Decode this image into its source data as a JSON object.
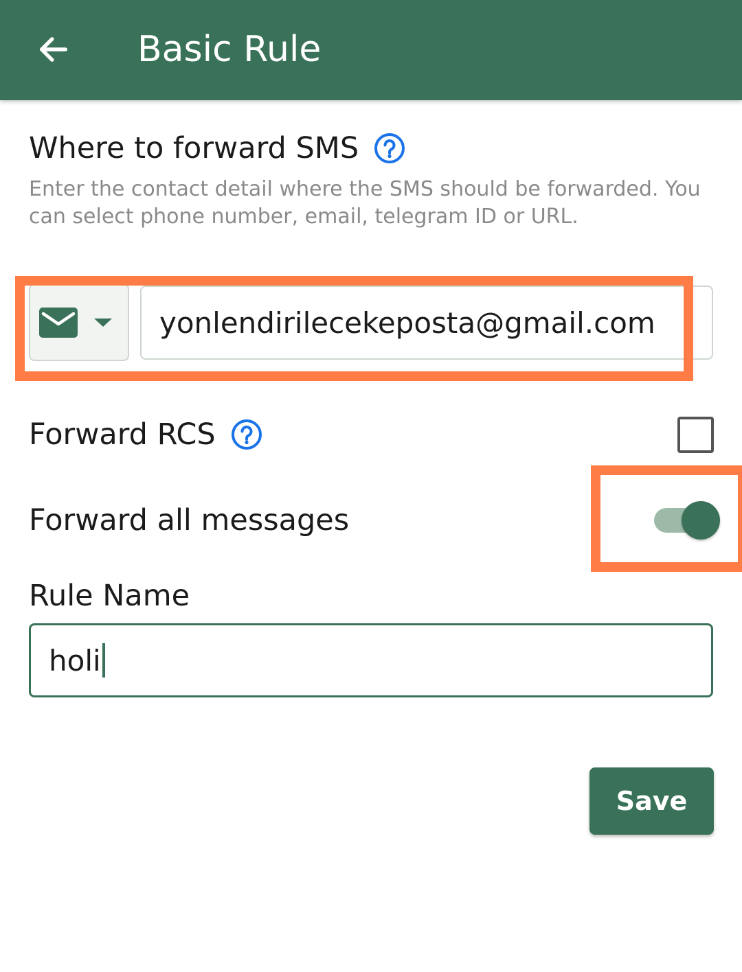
{
  "appbar": {
    "title": "Basic Rule",
    "back_icon": "arrow-left-icon"
  },
  "forward_section": {
    "title": "Where to forward SMS",
    "help_icon": "help-circle-icon",
    "description": "Enter the contact detail where the SMS should be forwarded. You can select phone number, email, telegram ID or URL.",
    "destination_type": "email",
    "destination_type_icon": "mail-icon",
    "destination_value": "yonlendirilecekeposta@gmail.com"
  },
  "forward_rcs": {
    "label": "Forward RCS",
    "help_icon": "help-circle-icon",
    "checked": false
  },
  "forward_all": {
    "label": "Forward all messages",
    "enabled": true
  },
  "rule_name": {
    "label": "Rule Name",
    "value": "holi"
  },
  "actions": {
    "save_label": "Save"
  },
  "colors": {
    "primary": "#3a7259",
    "highlight": "#ff7c47",
    "help": "#1a73e8"
  }
}
